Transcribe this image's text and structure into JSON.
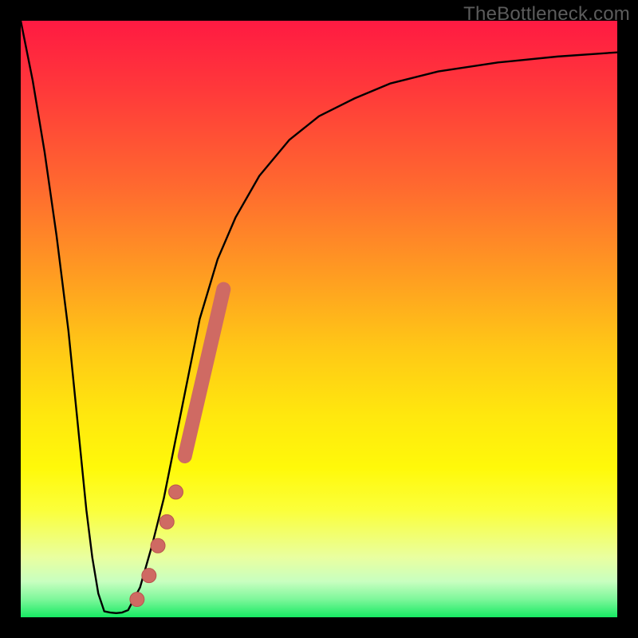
{
  "watermark": {
    "text": "TheBottleneck.com"
  },
  "colors": {
    "frame": "#000000",
    "curve_stroke": "#000000",
    "marker_fill": "#cf6a63",
    "marker_stroke": "#b9544e",
    "gradient_stops": [
      "#ff1a42",
      "#ff3a3a",
      "#ff6a2f",
      "#ff9a22",
      "#ffc816",
      "#ffe70e",
      "#fff90a",
      "#fbff3a",
      "#e9ffa0",
      "#c8ffc0",
      "#7df79a",
      "#17ea63"
    ]
  },
  "chart_data": {
    "type": "line",
    "title": "",
    "xlabel": "",
    "ylabel": "",
    "xlim": [
      0,
      100
    ],
    "ylim": [
      0,
      100
    ],
    "series": [
      {
        "name": "left-drop",
        "x": [
          0,
          2,
          4,
          6,
          8,
          10,
          11,
          12,
          13,
          14,
          15
        ],
        "y": [
          100,
          90,
          78,
          64,
          48,
          28,
          18,
          10,
          4,
          1,
          0.8
        ]
      },
      {
        "name": "trough",
        "x": [
          15,
          16,
          17,
          18
        ],
        "y": [
          0.8,
          0.7,
          0.8,
          1.2
        ]
      },
      {
        "name": "right-rise",
        "x": [
          18,
          20,
          22,
          24,
          26,
          28,
          30,
          33,
          36,
          40,
          45,
          50,
          56,
          62,
          70,
          80,
          90,
          100
        ],
        "y": [
          1.2,
          5,
          12,
          20,
          30,
          40,
          50,
          60,
          67,
          74,
          80,
          84,
          87,
          89.5,
          91.5,
          93,
          94,
          94.7
        ]
      }
    ],
    "markers": [
      {
        "name": "dot-1",
        "x": 19.5,
        "y": 3,
        "r": 1.2
      },
      {
        "name": "dot-2",
        "x": 21.5,
        "y": 7,
        "r": 1.2
      },
      {
        "name": "dot-3",
        "x": 23.0,
        "y": 12,
        "r": 1.2
      },
      {
        "name": "dot-4",
        "x": 24.5,
        "y": 16,
        "r": 1.2
      },
      {
        "name": "dot-5",
        "x": 26.0,
        "y": 21,
        "r": 1.2
      },
      {
        "name": "bar-segment",
        "x1": 27.5,
        "y1": 27,
        "x2": 34.0,
        "y2": 55,
        "w": 2.4
      }
    ]
  }
}
